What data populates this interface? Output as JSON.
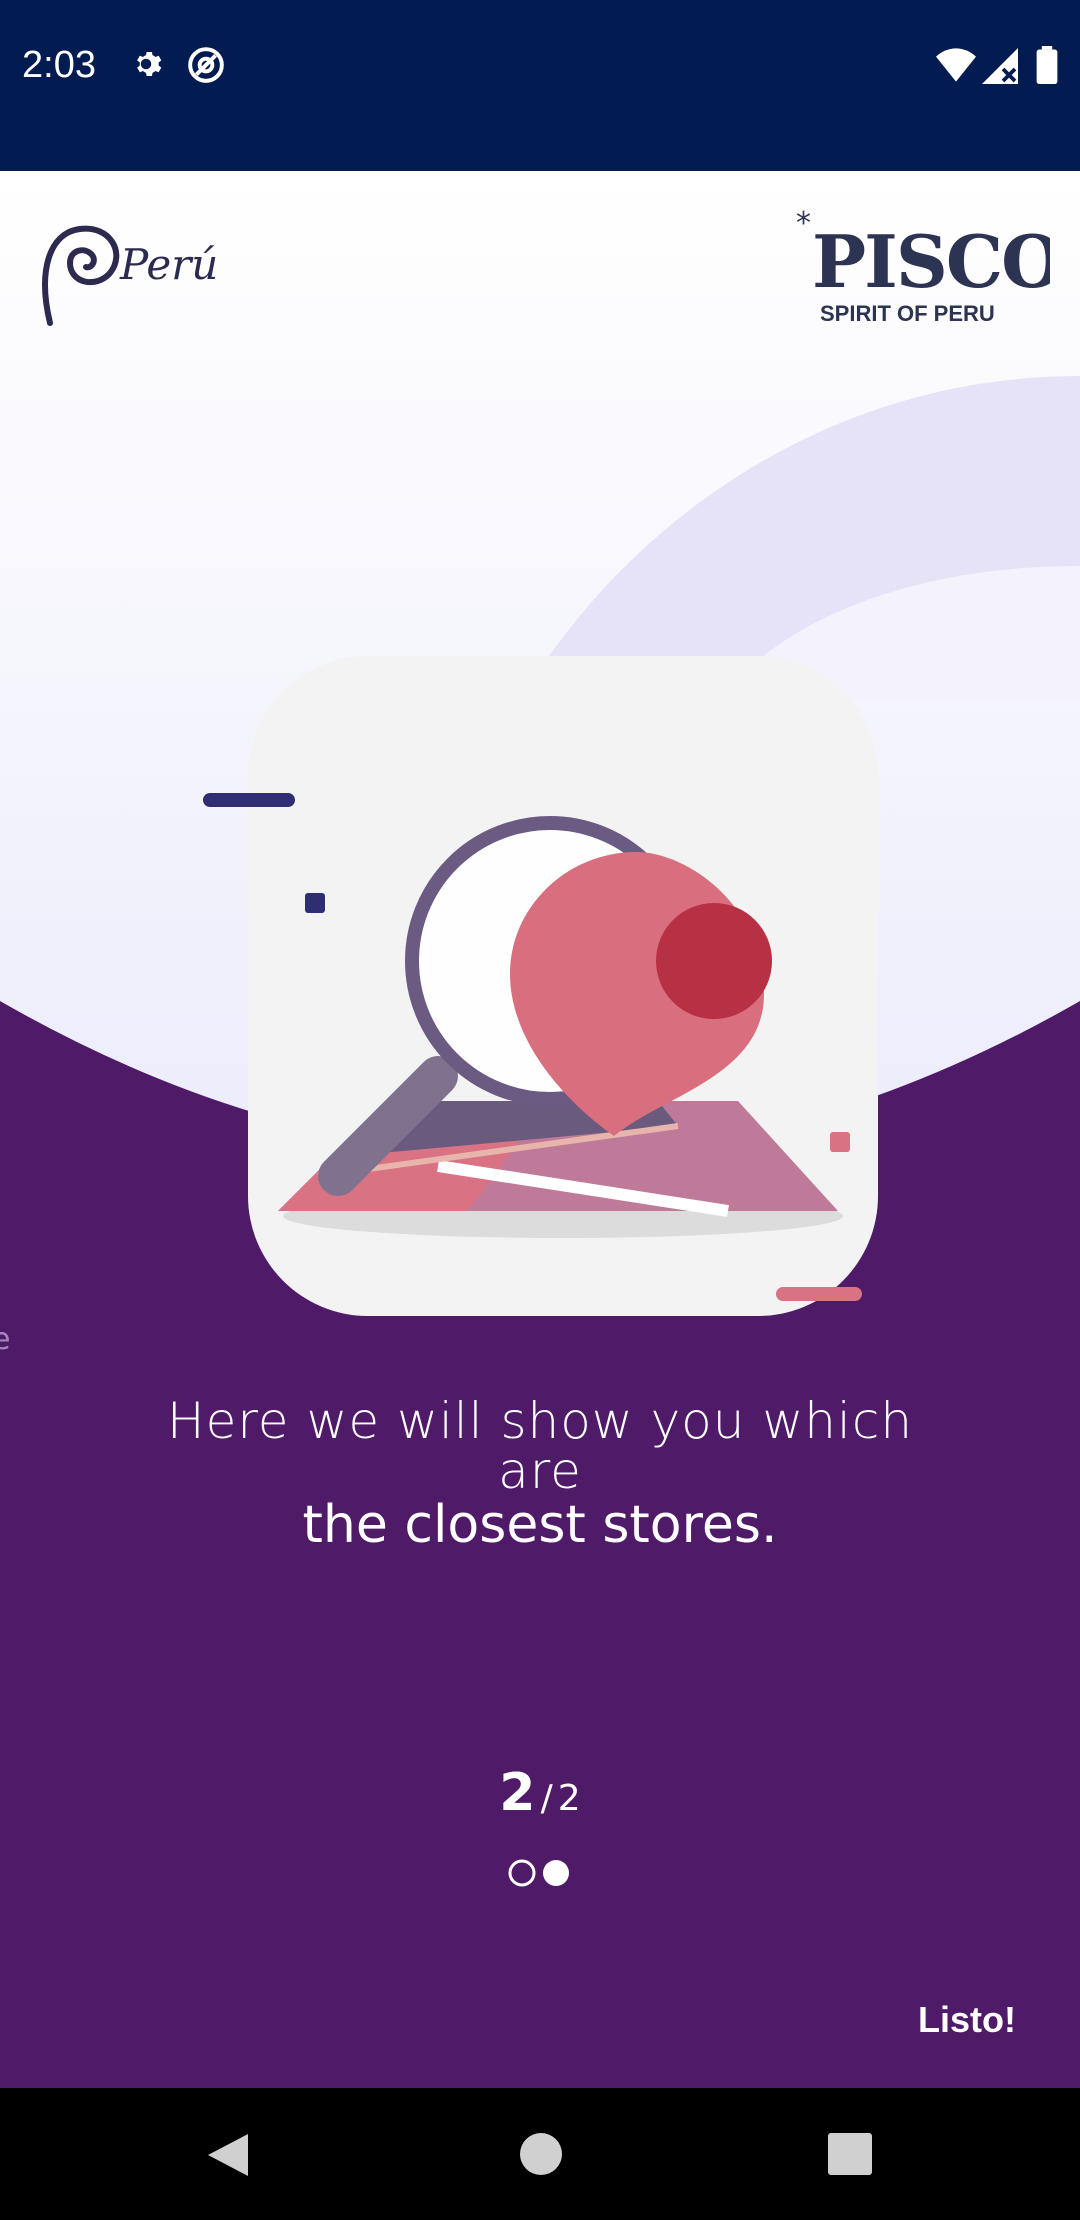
{
  "status_bar": {
    "time": "2:03",
    "icons": [
      "settings-icon",
      "at-sign-icon",
      "wifi-icon",
      "signal-icon",
      "battery-icon"
    ]
  },
  "header": {
    "left_logo_text": "Perú",
    "right_logo_title": "PISCO",
    "right_logo_subtitle": "SPIRIT OF PERU"
  },
  "onboarding": {
    "caption_line1": "Here we will show you which are",
    "caption_line2": "the closest stores.",
    "page_current": "2",
    "page_separator": "/",
    "page_total": "2",
    "dots": 2,
    "active_dot_index": 1,
    "done_label": "Listo!"
  },
  "colors": {
    "status_bar": "#021c52",
    "purple_bg": "#4f1a67",
    "accent_pink": "#d97283",
    "accent_navy": "#2f2e73"
  },
  "nav_bar": {
    "icons": [
      "back-icon",
      "home-icon",
      "recents-icon"
    ]
  }
}
